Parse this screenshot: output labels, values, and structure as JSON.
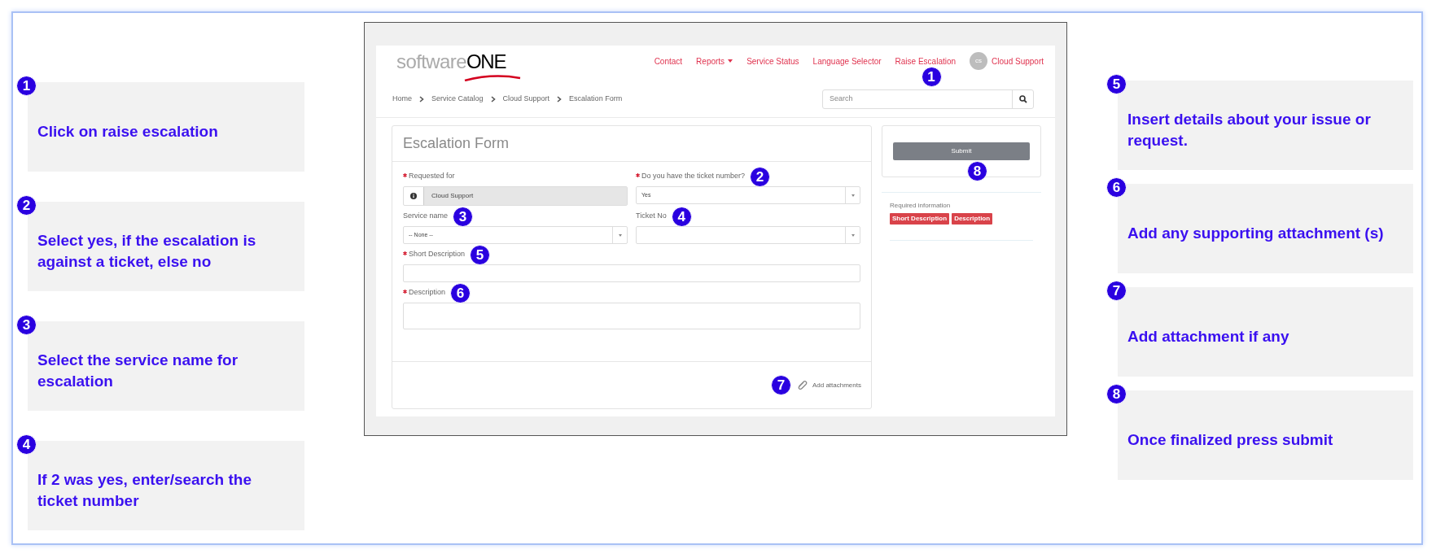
{
  "left_steps": [
    {
      "number": "1",
      "text": "Click on raise escalation"
    },
    {
      "number": "2",
      "text": "Select yes, if the escalation is against a ticket, else no"
    },
    {
      "number": "3",
      "text": "Select the service name for escalation"
    },
    {
      "number": "4",
      "text": "If 2 was yes, enter/search the ticket number"
    }
  ],
  "right_steps": [
    {
      "number": "5",
      "text": "Insert details about your issue or request."
    },
    {
      "number": "6",
      "text": "Add any supporting attachment (s)"
    },
    {
      "number": "7",
      "text": "Add attachment if any"
    },
    {
      "number": "8",
      "text": "Once finalized press submit"
    }
  ],
  "screenshot": {
    "logo": {
      "light": "software",
      "bold": "ONE"
    },
    "nav": [
      {
        "label": "Contact",
        "kind": "link"
      },
      {
        "label": "Reports",
        "kind": "dropdown"
      },
      {
        "label": "Service Status",
        "kind": "link"
      },
      {
        "label": "Language Selector",
        "kind": "link"
      },
      {
        "label": "Raise Escalation",
        "kind": "link",
        "marker": "1"
      }
    ],
    "user": {
      "initials": "cs",
      "name": "Cloud Support"
    },
    "breadcrumbs": [
      "Home",
      "Service Catalog",
      "Cloud Support",
      "Escalation Form"
    ],
    "search": {
      "placeholder": "Search"
    },
    "form": {
      "title": "Escalation Form",
      "rows": [
        [
          {
            "label": "Requested for",
            "required": true,
            "kind": "reference",
            "value": "Cloud Support"
          },
          {
            "label": "Do you have the ticket number?",
            "required": true,
            "kind": "select",
            "value": "Yes",
            "marker": "2"
          }
        ],
        [
          {
            "label": "Service name",
            "required": false,
            "kind": "select",
            "value": "-- None --",
            "marker": "3"
          },
          {
            "label": "Ticket No",
            "required": false,
            "kind": "select",
            "marker": "4"
          }
        ],
        [
          {
            "label": "Short Description",
            "required": true,
            "kind": "text",
            "marker": "5"
          }
        ],
        [
          {
            "label": "Description",
            "required": true,
            "kind": "textarea",
            "marker": "6"
          }
        ]
      ],
      "attachments": {
        "label": "Add attachments",
        "marker": "7"
      }
    },
    "submit": {
      "label": "Submit",
      "marker": "8"
    },
    "required_info": {
      "label": "Required information",
      "tags": [
        "Short Description",
        "Description"
      ]
    }
  }
}
